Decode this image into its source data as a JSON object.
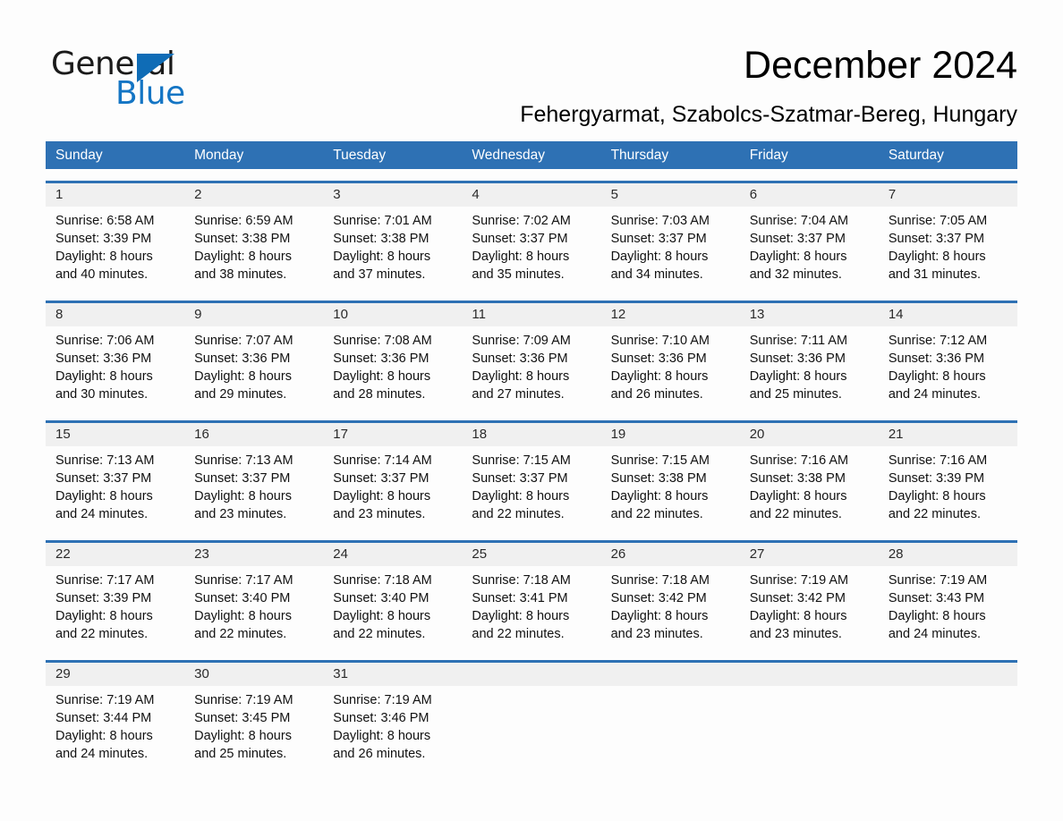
{
  "brand": {
    "name_part1": "General",
    "name_part2": "Blue",
    "triangle_color": "#0f6cb6",
    "blue_text_color": "#1475c4"
  },
  "header": {
    "title": "December 2024",
    "subtitle": "Fehergyarmat, Szabolcs-Szatmar-Bereg, Hungary"
  },
  "theme": {
    "header_blue": "#2e71b4",
    "daynum_band": "#f0f0f0",
    "page_bg": "#fdfdfd"
  },
  "calendar": {
    "weekdays": [
      "Sunday",
      "Monday",
      "Tuesday",
      "Wednesday",
      "Thursday",
      "Friday",
      "Saturday"
    ],
    "weeks": [
      [
        {
          "day": "1",
          "sunrise": "Sunrise: 6:58 AM",
          "sunset": "Sunset: 3:39 PM",
          "daylight1": "Daylight: 8 hours",
          "daylight2": "and 40 minutes."
        },
        {
          "day": "2",
          "sunrise": "Sunrise: 6:59 AM",
          "sunset": "Sunset: 3:38 PM",
          "daylight1": "Daylight: 8 hours",
          "daylight2": "and 38 minutes."
        },
        {
          "day": "3",
          "sunrise": "Sunrise: 7:01 AM",
          "sunset": "Sunset: 3:38 PM",
          "daylight1": "Daylight: 8 hours",
          "daylight2": "and 37 minutes."
        },
        {
          "day": "4",
          "sunrise": "Sunrise: 7:02 AM",
          "sunset": "Sunset: 3:37 PM",
          "daylight1": "Daylight: 8 hours",
          "daylight2": "and 35 minutes."
        },
        {
          "day": "5",
          "sunrise": "Sunrise: 7:03 AM",
          "sunset": "Sunset: 3:37 PM",
          "daylight1": "Daylight: 8 hours",
          "daylight2": "and 34 minutes."
        },
        {
          "day": "6",
          "sunrise": "Sunrise: 7:04 AM",
          "sunset": "Sunset: 3:37 PM",
          "daylight1": "Daylight: 8 hours",
          "daylight2": "and 32 minutes."
        },
        {
          "day": "7",
          "sunrise": "Sunrise: 7:05 AM",
          "sunset": "Sunset: 3:37 PM",
          "daylight1": "Daylight: 8 hours",
          "daylight2": "and 31 minutes."
        }
      ],
      [
        {
          "day": "8",
          "sunrise": "Sunrise: 7:06 AM",
          "sunset": "Sunset: 3:36 PM",
          "daylight1": "Daylight: 8 hours",
          "daylight2": "and 30 minutes."
        },
        {
          "day": "9",
          "sunrise": "Sunrise: 7:07 AM",
          "sunset": "Sunset: 3:36 PM",
          "daylight1": "Daylight: 8 hours",
          "daylight2": "and 29 minutes."
        },
        {
          "day": "10",
          "sunrise": "Sunrise: 7:08 AM",
          "sunset": "Sunset: 3:36 PM",
          "daylight1": "Daylight: 8 hours",
          "daylight2": "and 28 minutes."
        },
        {
          "day": "11",
          "sunrise": "Sunrise: 7:09 AM",
          "sunset": "Sunset: 3:36 PM",
          "daylight1": "Daylight: 8 hours",
          "daylight2": "and 27 minutes."
        },
        {
          "day": "12",
          "sunrise": "Sunrise: 7:10 AM",
          "sunset": "Sunset: 3:36 PM",
          "daylight1": "Daylight: 8 hours",
          "daylight2": "and 26 minutes."
        },
        {
          "day": "13",
          "sunrise": "Sunrise: 7:11 AM",
          "sunset": "Sunset: 3:36 PM",
          "daylight1": "Daylight: 8 hours",
          "daylight2": "and 25 minutes."
        },
        {
          "day": "14",
          "sunrise": "Sunrise: 7:12 AM",
          "sunset": "Sunset: 3:36 PM",
          "daylight1": "Daylight: 8 hours",
          "daylight2": "and 24 minutes."
        }
      ],
      [
        {
          "day": "15",
          "sunrise": "Sunrise: 7:13 AM",
          "sunset": "Sunset: 3:37 PM",
          "daylight1": "Daylight: 8 hours",
          "daylight2": "and 24 minutes."
        },
        {
          "day": "16",
          "sunrise": "Sunrise: 7:13 AM",
          "sunset": "Sunset: 3:37 PM",
          "daylight1": "Daylight: 8 hours",
          "daylight2": "and 23 minutes."
        },
        {
          "day": "17",
          "sunrise": "Sunrise: 7:14 AM",
          "sunset": "Sunset: 3:37 PM",
          "daylight1": "Daylight: 8 hours",
          "daylight2": "and 23 minutes."
        },
        {
          "day": "18",
          "sunrise": "Sunrise: 7:15 AM",
          "sunset": "Sunset: 3:37 PM",
          "daylight1": "Daylight: 8 hours",
          "daylight2": "and 22 minutes."
        },
        {
          "day": "19",
          "sunrise": "Sunrise: 7:15 AM",
          "sunset": "Sunset: 3:38 PM",
          "daylight1": "Daylight: 8 hours",
          "daylight2": "and 22 minutes."
        },
        {
          "day": "20",
          "sunrise": "Sunrise: 7:16 AM",
          "sunset": "Sunset: 3:38 PM",
          "daylight1": "Daylight: 8 hours",
          "daylight2": "and 22 minutes."
        },
        {
          "day": "21",
          "sunrise": "Sunrise: 7:16 AM",
          "sunset": "Sunset: 3:39 PM",
          "daylight1": "Daylight: 8 hours",
          "daylight2": "and 22 minutes."
        }
      ],
      [
        {
          "day": "22",
          "sunrise": "Sunrise: 7:17 AM",
          "sunset": "Sunset: 3:39 PM",
          "daylight1": "Daylight: 8 hours",
          "daylight2": "and 22 minutes."
        },
        {
          "day": "23",
          "sunrise": "Sunrise: 7:17 AM",
          "sunset": "Sunset: 3:40 PM",
          "daylight1": "Daylight: 8 hours",
          "daylight2": "and 22 minutes."
        },
        {
          "day": "24",
          "sunrise": "Sunrise: 7:18 AM",
          "sunset": "Sunset: 3:40 PM",
          "daylight1": "Daylight: 8 hours",
          "daylight2": "and 22 minutes."
        },
        {
          "day": "25",
          "sunrise": "Sunrise: 7:18 AM",
          "sunset": "Sunset: 3:41 PM",
          "daylight1": "Daylight: 8 hours",
          "daylight2": "and 22 minutes."
        },
        {
          "day": "26",
          "sunrise": "Sunrise: 7:18 AM",
          "sunset": "Sunset: 3:42 PM",
          "daylight1": "Daylight: 8 hours",
          "daylight2": "and 23 minutes."
        },
        {
          "day": "27",
          "sunrise": "Sunrise: 7:19 AM",
          "sunset": "Sunset: 3:42 PM",
          "daylight1": "Daylight: 8 hours",
          "daylight2": "and 23 minutes."
        },
        {
          "day": "28",
          "sunrise": "Sunrise: 7:19 AM",
          "sunset": "Sunset: 3:43 PM",
          "daylight1": "Daylight: 8 hours",
          "daylight2": "and 24 minutes."
        }
      ],
      [
        {
          "day": "29",
          "sunrise": "Sunrise: 7:19 AM",
          "sunset": "Sunset: 3:44 PM",
          "daylight1": "Daylight: 8 hours",
          "daylight2": "and 24 minutes."
        },
        {
          "day": "30",
          "sunrise": "Sunrise: 7:19 AM",
          "sunset": "Sunset: 3:45 PM",
          "daylight1": "Daylight: 8 hours",
          "daylight2": "and 25 minutes."
        },
        {
          "day": "31",
          "sunrise": "Sunrise: 7:19 AM",
          "sunset": "Sunset: 3:46 PM",
          "daylight1": "Daylight: 8 hours",
          "daylight2": "and 26 minutes."
        },
        {
          "day": "",
          "sunrise": "",
          "sunset": "",
          "daylight1": "",
          "daylight2": ""
        },
        {
          "day": "",
          "sunrise": "",
          "sunset": "",
          "daylight1": "",
          "daylight2": ""
        },
        {
          "day": "",
          "sunrise": "",
          "sunset": "",
          "daylight1": "",
          "daylight2": ""
        },
        {
          "day": "",
          "sunrise": "",
          "sunset": "",
          "daylight1": "",
          "daylight2": ""
        }
      ]
    ]
  }
}
